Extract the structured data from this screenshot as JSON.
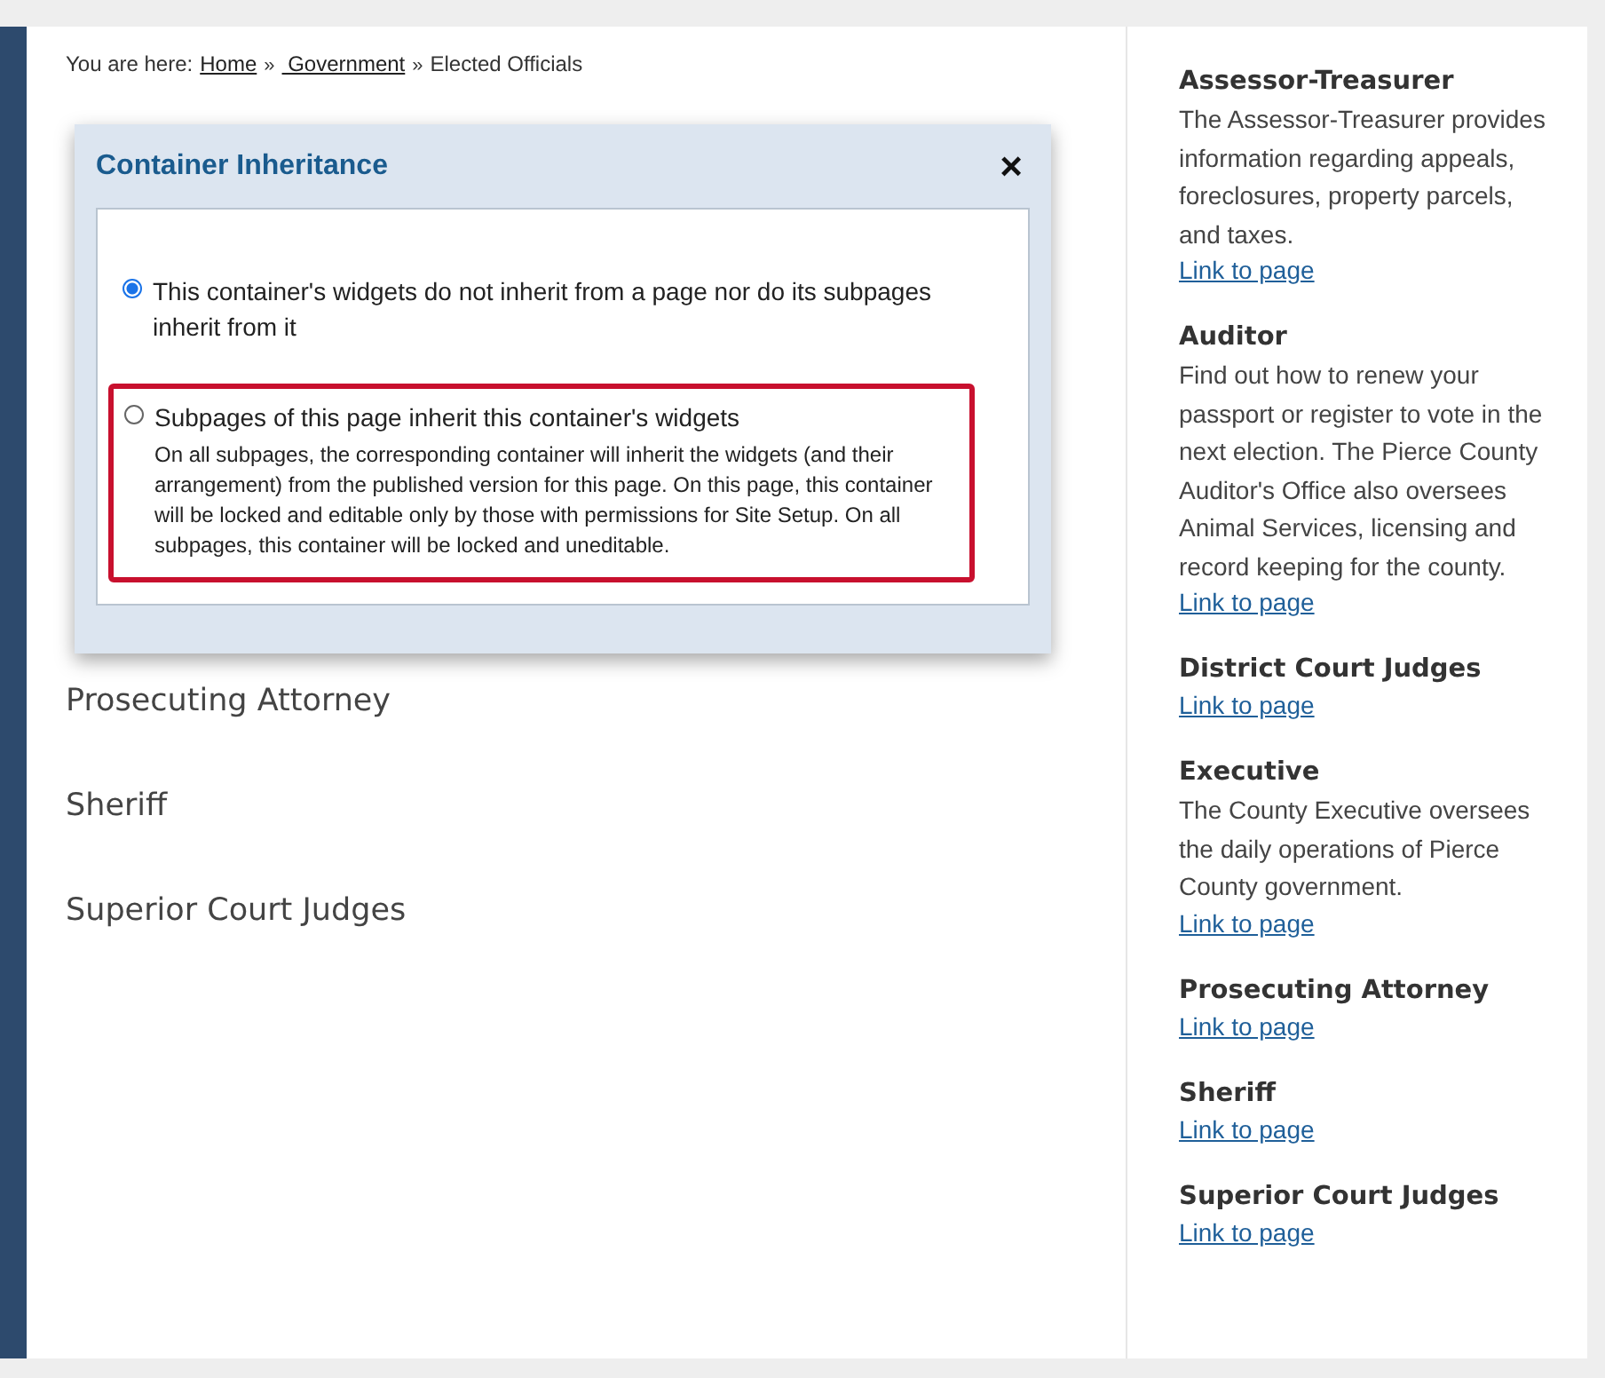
{
  "breadcrumb": {
    "prefix": "You are here:",
    "items": [
      {
        "label": "Home",
        "link": true,
        "separator": "»"
      },
      {
        "label": " Government",
        "link": true,
        "separator": "»"
      },
      {
        "label": "Elected Officials",
        "link": false
      }
    ]
  },
  "main_list": [
    "Prosecuting Attorney",
    "Sheriff",
    "Superior Court Judges"
  ],
  "dialog": {
    "title": "Container Inheritance",
    "close": "×",
    "options": [
      {
        "label": "This container's widgets do not inherit from a page nor do its subpages inherit from it",
        "selected": true,
        "highlighted": false
      },
      {
        "label": "Subpages of this page inherit this container's widgets",
        "description": "On all subpages, the corresponding container will inherit the widgets (and their arrangement) from the published version for this page. On this page, this container will be locked and editable only by those with permissions for Site Setup. On all subpages, this container will be locked and uneditable.",
        "selected": false,
        "highlighted": true
      }
    ]
  },
  "sidebar": [
    {
      "title": "Assessor-Treasurer",
      "text": "The Assessor-Treasurer provides information regarding appeals, foreclosures, property parcels, and taxes.",
      "link": "Link to page"
    },
    {
      "title": "Auditor",
      "text": "Find out how to renew your passport or register to vote in the next election. The Pierce County Auditor's Office also oversees Animal Services, licensing and record keeping for the county.",
      "link": "Link to page"
    },
    {
      "title": "District Court Judges",
      "link": "Link to page"
    },
    {
      "title": "Executive",
      "text": "The County Executive oversees the daily operations of Pierce County government.",
      "link": "Link to page"
    },
    {
      "title": "Prosecuting Attorney",
      "link": "Link to page"
    },
    {
      "title": "Sheriff",
      "link": "Link to page"
    },
    {
      "title": "Superior Court Judges",
      "link": "Link to page"
    }
  ]
}
